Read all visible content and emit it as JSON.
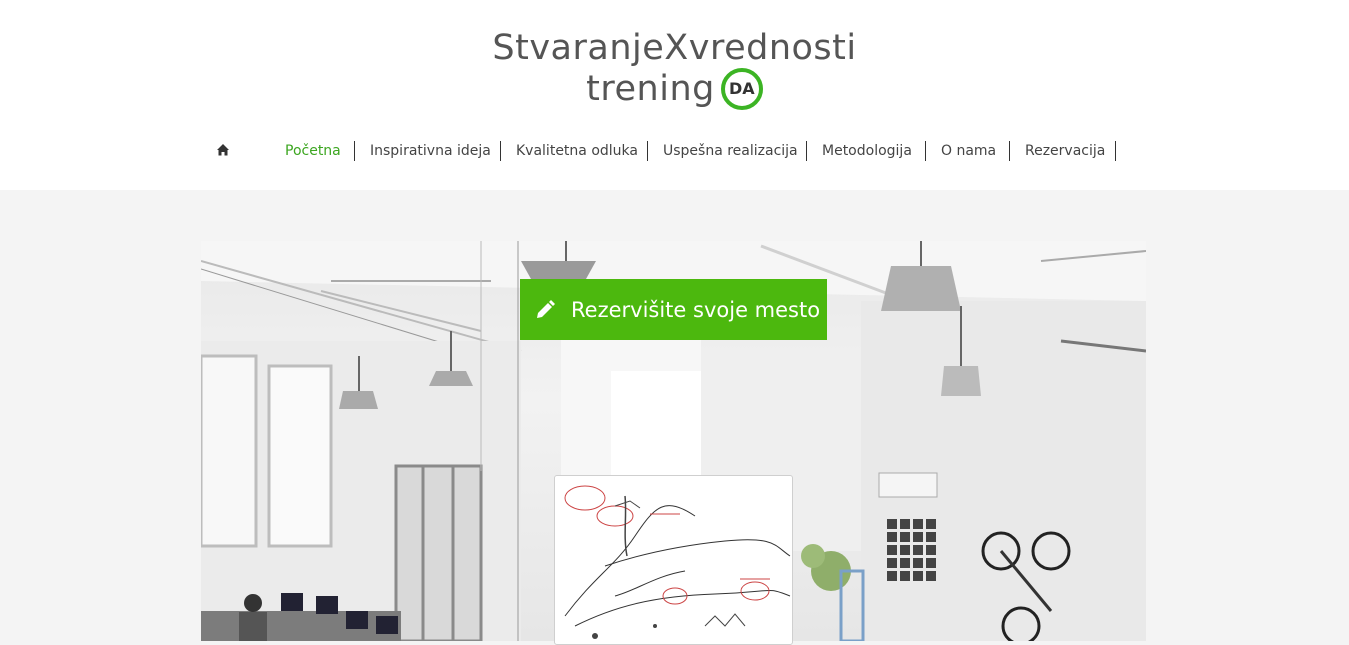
{
  "site": {
    "title_line1": "StvaranjeXvrednosti",
    "title_line2": "trening",
    "badge": "DA",
    "accent_color": "#3cb424"
  },
  "nav": {
    "home_icon": "home-icon",
    "items": [
      {
        "label": "Početna",
        "active": true
      },
      {
        "label": "Inspirativna ideja",
        "active": false
      },
      {
        "label": "Kvalitetna odluka",
        "active": false
      },
      {
        "label": "Uspešna realizacija",
        "active": false
      },
      {
        "label": "Metodologija",
        "active": false
      },
      {
        "label": "O nama",
        "active": false
      },
      {
        "label": "Rezervacija",
        "active": false
      }
    ]
  },
  "hero": {
    "cta_label": "Rezervišite svoje mesto",
    "cta_icon": "pencil-icon",
    "cta_color": "#4cb80e"
  }
}
